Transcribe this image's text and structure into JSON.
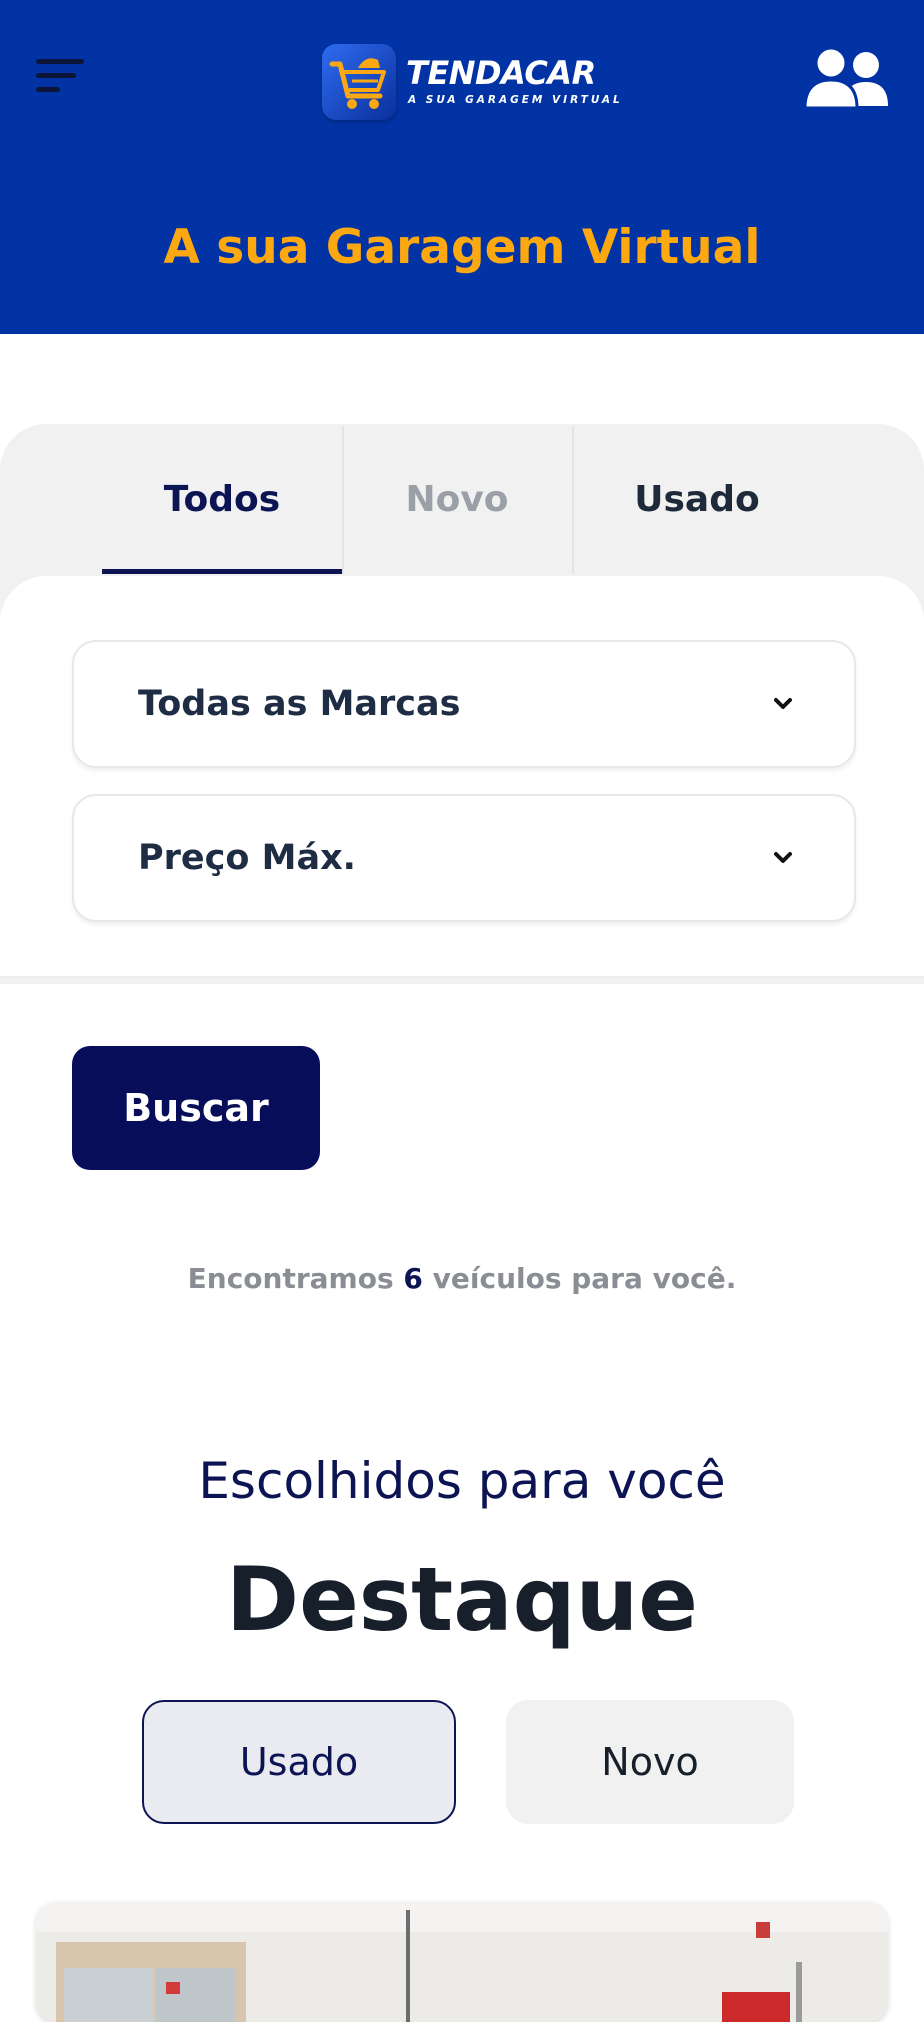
{
  "header": {
    "logo_title": "TENDACAR",
    "logo_subtitle": "A SUA GARAGEM VIRTUAL",
    "tagline": "A sua Garagem Virtual",
    "menu_icon": "menu-icon",
    "account_icon": "users-icon"
  },
  "tabs": [
    {
      "label": "Todos",
      "active": true
    },
    {
      "label": "Novo",
      "active": false
    },
    {
      "label": "Usado",
      "active": false
    }
  ],
  "filters": {
    "brand": {
      "value": "Todas as Marcas"
    },
    "price": {
      "value": "Preço Máx."
    }
  },
  "search_button": "Buscar",
  "results": {
    "prefix": "Encontramos",
    "count": "6",
    "suffix": "veículos para você."
  },
  "featured": {
    "subtitle": "Escolhidos para você",
    "title": "Destaque",
    "toggle": [
      {
        "label": "Usado",
        "selected": true
      },
      {
        "label": "Novo",
        "selected": false
      }
    ]
  },
  "colors": {
    "header_bg": "#0233a5",
    "tagline": "#fca811",
    "primary": "#070d59",
    "accent_navy": "#0d1454"
  }
}
